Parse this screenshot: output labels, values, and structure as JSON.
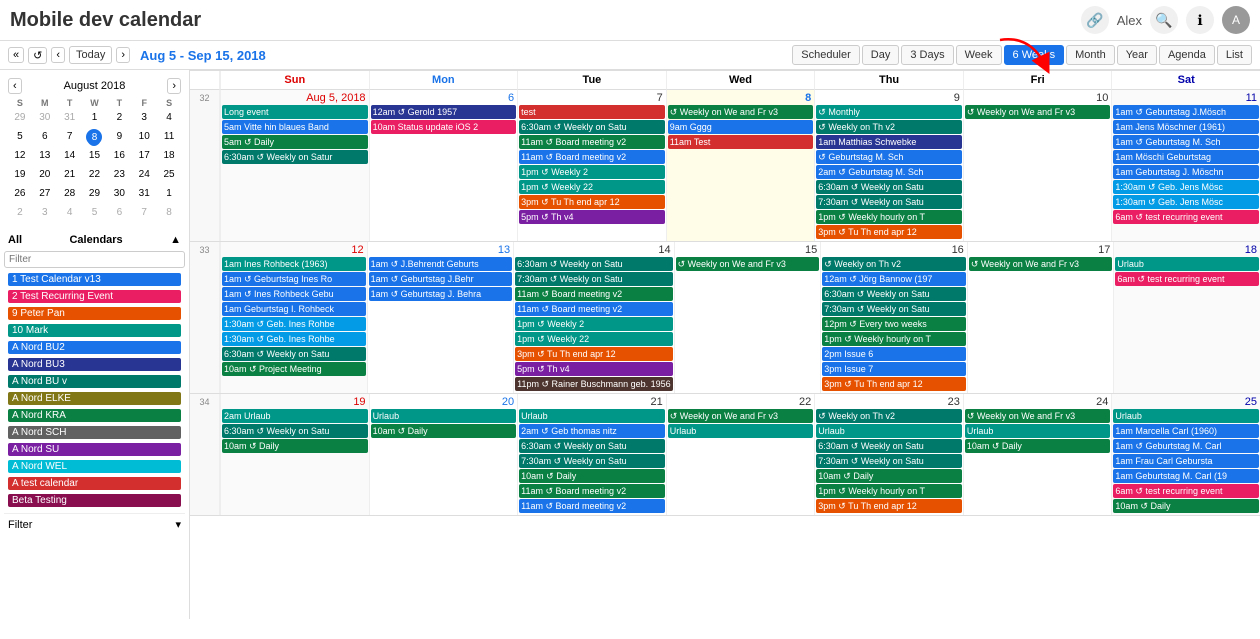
{
  "header": {
    "title": "Mobile dev calendar",
    "user": "Alex",
    "icons": [
      "search",
      "info",
      "user"
    ]
  },
  "toolbar": {
    "nav_prev": "‹",
    "nav_next": "›",
    "today": "Today",
    "date_range": "Aug 5 - Sep 15, 2018",
    "views": [
      "Scheduler",
      "Day",
      "3 Days",
      "Week",
      "6 Weeks",
      "Month",
      "Year",
      "Agenda",
      "List"
    ],
    "active_view": "6 Weeks"
  },
  "mini_calendar": {
    "month": "August",
    "year": "2018",
    "days_of_week": [
      "S",
      "M",
      "T",
      "W",
      "T",
      "F",
      "S"
    ],
    "weeks": [
      [
        "29",
        "30",
        "31",
        "1",
        "2",
        "3",
        "4"
      ],
      [
        "5",
        "6",
        "7",
        "8",
        "9",
        "10",
        "11"
      ],
      [
        "12",
        "13",
        "14",
        "15",
        "16",
        "17",
        "18"
      ],
      [
        "19",
        "20",
        "21",
        "22",
        "23",
        "24",
        "25"
      ],
      [
        "26",
        "27",
        "28",
        "29",
        "30",
        "31",
        "1"
      ],
      [
        "2",
        "3",
        "4",
        "5",
        "6",
        "7",
        "8"
      ]
    ],
    "today": "8"
  },
  "sidebar": {
    "calendars_label": "Calendars",
    "all_label": "All",
    "filter_placeholder": "Filter",
    "items": [
      {
        "label": "1 Test Calendar v13",
        "color": "#1a73e8"
      },
      {
        "label": "2 Test Recurring Event",
        "color": "#e91e63"
      },
      {
        "label": "9 Peter Pan",
        "color": "#e65100"
      },
      {
        "label": "10 Mark",
        "color": "#009688"
      },
      {
        "label": "A Nord BU2",
        "color": "#1a73e8"
      },
      {
        "label": "A Nord BU3",
        "color": "#283593"
      },
      {
        "label": "A Nord BU v",
        "color": "#00796b"
      },
      {
        "label": "A Nord ELKE",
        "color": "#827717"
      },
      {
        "label": "A Nord KRA",
        "color": "#0b8043"
      },
      {
        "label": "A Nord SCH",
        "color": "#616161"
      },
      {
        "label": "A Nord SU",
        "color": "#7b1fa2"
      },
      {
        "label": "A Nord WEL",
        "color": "#00bcd4"
      },
      {
        "label": "A test calendar",
        "color": "#d32f2f"
      },
      {
        "label": "Beta Testing",
        "color": "#880e4f"
      }
    ],
    "filter_bottom": "Filter"
  },
  "calendar": {
    "headers": [
      "Sun",
      "Mon",
      "Tue",
      "Wed",
      "Thu",
      "Fri",
      "Sat"
    ],
    "weeks": [
      {
        "week_num": "32",
        "days": [
          {
            "num": "Aug 5, 2018",
            "is_today": false,
            "is_sun": true,
            "span": true,
            "events": [
              {
                "text": "Long event",
                "class": "event-teal"
              },
              {
                "text": "5am Vitte hin blaues Band",
                "class": "event-blue"
              },
              {
                "text": "5am ↺ Daily",
                "class": "event-green"
              },
              {
                "text": "6:30am ↺ Weekly on Satur",
                "class": "event-dark-teal"
              }
            ]
          },
          {
            "num": "6",
            "is_mon": true,
            "events": [
              {
                "text": "12am ↺ Gerold 1957",
                "class": "event-indigo"
              },
              {
                "text": "10am Status update iOS 2",
                "class": "event-pink"
              }
            ]
          },
          {
            "num": "7",
            "events": [
              {
                "text": "test",
                "class": "event-red"
              },
              {
                "text": "6:30am ↺ Weekly on Satu",
                "class": "event-dark-teal"
              },
              {
                "text": "11am ↺ Board meeting v2",
                "class": "event-green"
              },
              {
                "text": "11am ↺ Board meeting v2",
                "class": "event-blue"
              },
              {
                "text": "1pm ↺ Weekly 2",
                "class": "event-teal"
              },
              {
                "text": "1pm ↺ Weekly 22",
                "class": "event-teal"
              },
              {
                "text": "3pm ↺ Tu Th end apr 12",
                "class": "event-orange"
              },
              {
                "text": "5pm ↺ Th v4",
                "class": "event-purple"
              }
            ]
          },
          {
            "num": "8",
            "is_today": true,
            "events": [
              {
                "text": "↺ Weekly on We and Fr v3",
                "class": "event-green"
              },
              {
                "text": "9am Gggg",
                "class": "event-blue"
              },
              {
                "text": "11am Test",
                "class": "event-red"
              }
            ]
          },
          {
            "num": "9",
            "events": [
              {
                "text": "↺ Monthly",
                "class": "event-teal"
              },
              {
                "text": "↺ Weekly on Th v2",
                "class": "event-dark-teal"
              },
              {
                "text": "1am Matthias Schwebke",
                "class": "event-indigo"
              },
              {
                "text": "↺ Geburtstag M. Sch",
                "class": "event-blue"
              },
              {
                "text": "2am ↺ Geburtstag M. Sch",
                "class": "event-blue"
              },
              {
                "text": "6:30am ↺ Weekly on Satu",
                "class": "event-dark-teal"
              },
              {
                "text": "7:30am ↺ Weekly on Satu",
                "class": "event-dark-teal"
              },
              {
                "text": "1pm ↺ Weekly hourly on T",
                "class": "event-green"
              },
              {
                "text": "3pm ↺ Tu Th end apr 12",
                "class": "event-orange"
              }
            ]
          },
          {
            "num": "10",
            "events": [
              {
                "text": "↺ Weekly on We and Fr v3",
                "class": "event-green"
              }
            ]
          },
          {
            "num": "11",
            "is_sat": true,
            "events": [
              {
                "text": "1am ↺ Geburtstag J.Mösch",
                "class": "event-blue"
              },
              {
                "text": "1am Jens Möschner (1961)",
                "class": "event-blue"
              },
              {
                "text": "1am ↺ Geburtstag M. Sch",
                "class": "event-blue"
              },
              {
                "text": "1am Möschi Geburtstag",
                "class": "event-blue"
              },
              {
                "text": "1am Geburtstag J. Möschn",
                "class": "event-blue"
              },
              {
                "text": "1:30am ↺ Geb. Jens Mösc",
                "class": "event-light-blue"
              },
              {
                "text": "1:30am ↺ Geb. Jens Mösc",
                "class": "event-light-blue"
              },
              {
                "text": "6am ↺ test recurring event",
                "class": "event-pink"
              }
            ]
          }
        ]
      },
      {
        "week_num": "33",
        "days": [
          {
            "num": "12",
            "is_sun": true,
            "events": [
              {
                "text": "1am Ines Rohbeck (1963)",
                "class": "event-teal"
              },
              {
                "text": "1am ↺ Geburtstag Ines Ro",
                "class": "event-blue"
              },
              {
                "text": "1am ↺ Ines Rohbeck Gebu",
                "class": "event-blue"
              },
              {
                "text": "1am Geburtstag I. Rohbeck",
                "class": "event-blue"
              },
              {
                "text": "1:30am ↺ Geb. Ines Rohbe",
                "class": "event-light-blue"
              },
              {
                "text": "1:30am ↺ Geb. Ines Rohbe",
                "class": "event-light-blue"
              },
              {
                "text": "6:30am ↺ Weekly on Satu",
                "class": "event-dark-teal"
              },
              {
                "text": "10am ↺ Project Meeting",
                "class": "event-green"
              }
            ]
          },
          {
            "num": "13",
            "is_mon": true,
            "events": [
              {
                "text": "1am ↺ J.Behrendt Geburts",
                "class": "event-blue"
              },
              {
                "text": "1am ↺ Geburtstag J.Behr",
                "class": "event-blue"
              },
              {
                "text": "1am ↺ Geburtstag J. Behra",
                "class": "event-blue"
              }
            ]
          },
          {
            "num": "14",
            "events": [
              {
                "text": "6:30am ↺ Weekly on Satu",
                "class": "event-dark-teal"
              },
              {
                "text": "7:30am ↺ Weekly on Satu",
                "class": "event-dark-teal"
              },
              {
                "text": "11am ↺ Board meeting v2",
                "class": "event-green"
              },
              {
                "text": "11am ↺ Board meeting v2",
                "class": "event-blue"
              },
              {
                "text": "1pm ↺ Weekly 2",
                "class": "event-teal"
              },
              {
                "text": "1pm ↺ Weekly 22",
                "class": "event-teal"
              },
              {
                "text": "3pm ↺ Tu Th end apr 12",
                "class": "event-orange"
              },
              {
                "text": "5pm ↺ Th v4",
                "class": "event-purple"
              },
              {
                "text": "11pm ↺ Rainer Buschmann geb. 1956",
                "class": "event-brown"
              }
            ]
          },
          {
            "num": "15",
            "events": [
              {
                "text": "↺ Weekly on We and Fr v3",
                "class": "event-green"
              }
            ]
          },
          {
            "num": "16",
            "events": [
              {
                "text": "↺ Weekly on Th v2",
                "class": "event-dark-teal"
              },
              {
                "text": "12am ↺ Jörg Bannow (197",
                "class": "event-blue"
              },
              {
                "text": "6:30am ↺ Weekly on Satu",
                "class": "event-dark-teal"
              },
              {
                "text": "7:30am ↺ Weekly on Satu",
                "class": "event-dark-teal"
              },
              {
                "text": "12pm ↺ Every two weeks",
                "class": "event-green"
              },
              {
                "text": "1pm ↺ Weekly hourly on T",
                "class": "event-green"
              },
              {
                "text": "2pm Issue 6",
                "class": "event-blue"
              },
              {
                "text": "3pm Issue 7",
                "class": "event-blue"
              },
              {
                "text": "3pm ↺ Tu Th end apr 12",
                "class": "event-orange"
              }
            ]
          },
          {
            "num": "17",
            "events": [
              {
                "text": "↺ Weekly on We and Fr v3",
                "class": "event-green"
              }
            ]
          },
          {
            "num": "18",
            "is_sat": true,
            "events": [
              {
                "text": "Urlaub",
                "class": "event-teal"
              },
              {
                "text": "6am ↺ test recurring event",
                "class": "event-pink"
              }
            ]
          }
        ]
      },
      {
        "week_num": "34",
        "days": [
          {
            "num": "19",
            "is_sun": true,
            "events": [
              {
                "text": "2am Urlaub",
                "class": "event-teal"
              },
              {
                "text": "6:30am ↺ Weekly on Satu",
                "class": "event-dark-teal"
              },
              {
                "text": "10am ↺ Daily",
                "class": "event-green"
              }
            ]
          },
          {
            "num": "20",
            "is_mon": true,
            "events": [
              {
                "text": "Urlaub",
                "class": "event-teal"
              },
              {
                "text": "10am ↺ Daily",
                "class": "event-green"
              }
            ]
          },
          {
            "num": "21",
            "events": [
              {
                "text": "Urlaub",
                "class": "event-teal"
              },
              {
                "text": "2am ↺ Geb thomas nitz",
                "class": "event-blue"
              },
              {
                "text": "6:30am ↺ Weekly on Satu",
                "class": "event-dark-teal"
              },
              {
                "text": "7:30am ↺ Weekly on Satu",
                "class": "event-dark-teal"
              },
              {
                "text": "10am ↺ Daily",
                "class": "event-green"
              },
              {
                "text": "11am ↺ Board meeting v2",
                "class": "event-green"
              },
              {
                "text": "11am ↺ Board meeting v2",
                "class": "event-blue"
              }
            ]
          },
          {
            "num": "22",
            "events": [
              {
                "text": "↺ Weekly on We and Fr v3",
                "class": "event-green"
              },
              {
                "text": "Urlaub",
                "class": "event-teal"
              }
            ]
          },
          {
            "num": "23",
            "events": [
              {
                "text": "↺ Weekly on Th v2",
                "class": "event-dark-teal"
              },
              {
                "text": "Urlaub",
                "class": "event-teal"
              },
              {
                "text": "6:30am ↺ Weekly on Satu",
                "class": "event-dark-teal"
              },
              {
                "text": "7:30am ↺ Weekly on Satu",
                "class": "event-dark-teal"
              },
              {
                "text": "10am ↺ Daily",
                "class": "event-green"
              },
              {
                "text": "1pm ↺ Weekly hourly on T",
                "class": "event-green"
              },
              {
                "text": "3pm ↺ Tu Th end apr 12",
                "class": "event-orange"
              }
            ]
          },
          {
            "num": "24",
            "events": [
              {
                "text": "↺ Weekly on We and Fr v3",
                "class": "event-green"
              },
              {
                "text": "Urlaub",
                "class": "event-teal"
              },
              {
                "text": "10am ↺ Daily",
                "class": "event-green"
              }
            ]
          },
          {
            "num": "25",
            "is_sat": true,
            "events": [
              {
                "text": "Urlaub",
                "class": "event-teal"
              },
              {
                "text": "1am Marcella Carl (1960)",
                "class": "event-blue"
              },
              {
                "text": "1am ↺ Geburtstag M. Carl",
                "class": "event-blue"
              },
              {
                "text": "1am Frau Carl Gebursta",
                "class": "event-blue"
              },
              {
                "text": "1am Geburtstag M. Carl (19",
                "class": "event-blue"
              },
              {
                "text": "6am ↺ test recurring event",
                "class": "event-pink"
              },
              {
                "text": "10am ↺ Daily",
                "class": "event-green"
              }
            ]
          }
        ]
      }
    ]
  }
}
